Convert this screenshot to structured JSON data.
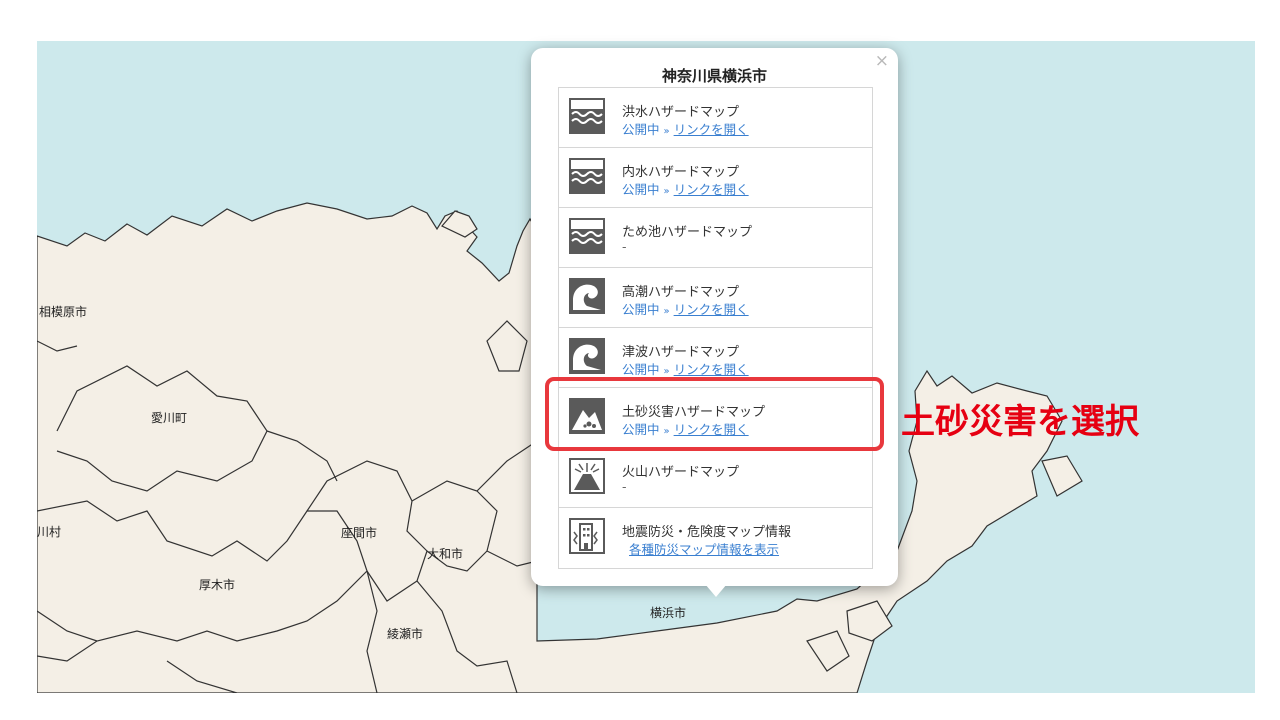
{
  "map": {
    "colors": {
      "sea": "#cde9ec",
      "land": "#f4efe6",
      "border": "#333333"
    },
    "city_labels": [
      {
        "key": "sagamihara",
        "text": "相模原市"
      },
      {
        "key": "aikawa",
        "text": "愛川町"
      },
      {
        "key": "kiyokawa",
        "text": "川村"
      },
      {
        "key": "atsugi",
        "text": "厚木市"
      },
      {
        "key": "zama",
        "text": "座間市"
      },
      {
        "key": "yamato",
        "text": "大和市"
      },
      {
        "key": "ayase",
        "text": "綾瀬市"
      },
      {
        "key": "yokohama",
        "text": "横浜市"
      }
    ]
  },
  "popup": {
    "close_label": "×",
    "title": "神奈川県横浜市",
    "items": [
      {
        "icon": "flood-wave-icon",
        "title": "洪水ハザードマップ",
        "status": "公開中",
        "arrow": "»",
        "link": "リンクを開く"
      },
      {
        "icon": "flood-wave-icon",
        "title": "内水ハザードマップ",
        "status": "公開中",
        "arrow": "»",
        "link": "リンクを開く"
      },
      {
        "icon": "flood-wave-icon",
        "title": "ため池ハザードマップ",
        "status": "-"
      },
      {
        "icon": "tsunami-wave-icon",
        "title": "高潮ハザードマップ",
        "status": "公開中",
        "arrow": "»",
        "link": "リンクを開く"
      },
      {
        "icon": "tsunami-wave-icon",
        "title": "津波ハザードマップ",
        "status": "公開中",
        "arrow": "»",
        "link": "リンクを開く"
      },
      {
        "icon": "landslide-icon",
        "title": "土砂災害ハザードマップ",
        "status": "公開中",
        "arrow": "»",
        "link": "リンクを開く"
      },
      {
        "icon": "volcano-icon",
        "title": "火山ハザードマップ",
        "status": "-"
      },
      {
        "icon": "building-info-icon",
        "title": "地震防災・危険度マップ情報",
        "link": "各種防災マップ情報を表示"
      }
    ]
  },
  "annotation": {
    "text": "土砂災害を選択",
    "color": "#e60012"
  }
}
